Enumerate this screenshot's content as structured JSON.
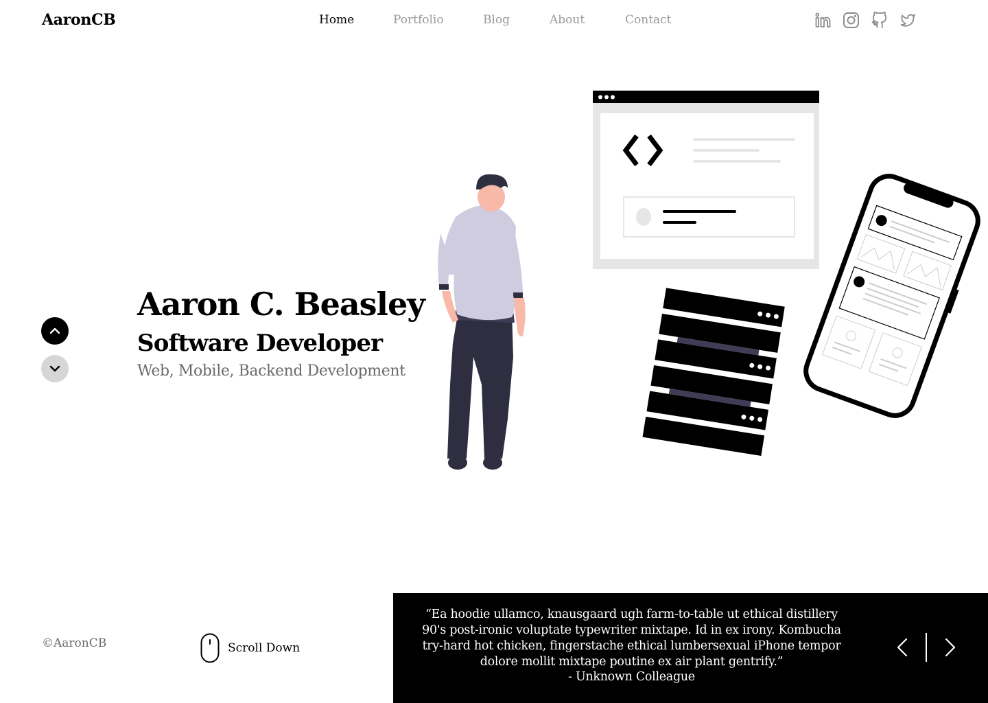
{
  "header": {
    "logo": "AaronCB",
    "nav": [
      {
        "label": "Home",
        "active": true
      },
      {
        "label": "Portfolio",
        "active": false
      },
      {
        "label": "Blog",
        "active": false
      },
      {
        "label": "About",
        "active": false
      },
      {
        "label": "Contact",
        "active": false
      }
    ],
    "social_icons": [
      "linkedin-icon",
      "instagram-icon",
      "github-icon",
      "twitter-icon"
    ]
  },
  "hero": {
    "name": "Aaron C. Beasley",
    "role": "Software Developer",
    "subtitle": "Web, Mobile, Backend Development"
  },
  "side_controls": {
    "up_icon": "chevron-up-icon",
    "down_icon": "chevron-down-icon"
  },
  "footer": {
    "copyright": "©AaronCB",
    "scroll_label": "Scroll Down",
    "scroll_icon": "mouse-icon"
  },
  "quote": {
    "text": "“Ea hoodie ullamco, knausgaard ugh farm-to-table ut ethical distillery 90's post-ironic voluptate typewriter mixtape. Id in ex irony. Kombucha try-hard hot chicken, fingerstache ethical lumbersexual iPhone tempor dolore mollit mixtape poutine ex air plant gentrify.”",
    "author": "- Unknown Colleague",
    "prev_icon": "chevron-left-icon",
    "next_icon": "chevron-right-icon"
  },
  "colors": {
    "primary": "#000000",
    "muted_text": "#6a6a6a",
    "nav_inactive": "#9a9a9a",
    "person_shirt": "#cfccdf",
    "person_pants": "#2f2e41",
    "skin": "#f8b9a9",
    "light_gray": "#e6e6e6"
  }
}
